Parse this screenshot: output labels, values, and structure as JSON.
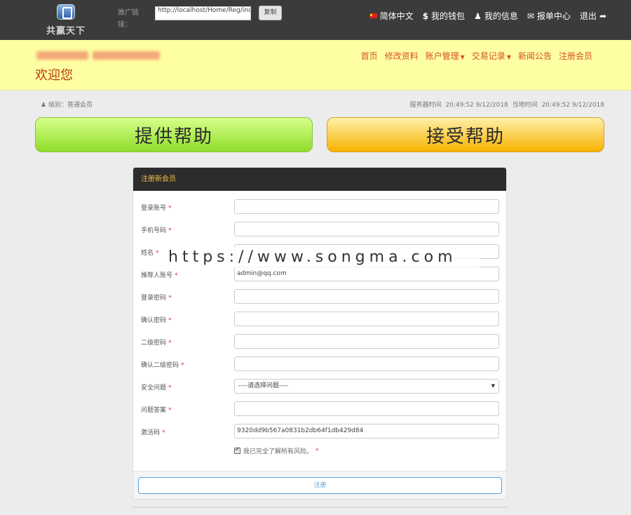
{
  "topbar": {
    "logo_text": "共赢天下",
    "promo_label": "推广链接：",
    "promo_url": "http://localhost/Home/Reg/index/u",
    "copy_label": "复制",
    "nav": {
      "language": "简体中文",
      "wallet": "我的钱包",
      "profile": "我的信息",
      "report_center": "报单中心",
      "logout": "退出"
    }
  },
  "banner": {
    "welcome": "欢迎您",
    "nav": [
      "首页",
      "修改资料",
      "账户管理",
      "交易记录",
      "新闻公告",
      "注册会员"
    ]
  },
  "info": {
    "level": "级别：普通会员",
    "server_time_label": "服务器时间",
    "server_time": "20:49:52 9/12/2018",
    "local_time_label": "当地时间",
    "local_time": "20:49:52 9/12/2018"
  },
  "actions": {
    "provide_help": "提供帮助",
    "accept_help": "接受帮助"
  },
  "form": {
    "title": "注册新会员",
    "fields": [
      {
        "label": "登录账号",
        "value": ""
      },
      {
        "label": "手机号码",
        "value": ""
      },
      {
        "label": "姓名",
        "value": ""
      },
      {
        "label": "推荐人账号",
        "value": "admin@qq.com"
      },
      {
        "label": "登录密码",
        "value": ""
      },
      {
        "label": "确认密码",
        "value": ""
      },
      {
        "label": "二级密码",
        "value": ""
      },
      {
        "label": "确认二级密码",
        "value": ""
      },
      {
        "label": "安全问题",
        "value": "----请选择问题----"
      },
      {
        "label": "问题答案",
        "value": ""
      },
      {
        "label": "激活码",
        "value": "9320dd9b567a0831b2db64f1db429d84"
      }
    ],
    "required_mark": "*",
    "agree_text": "我已完全了解所有风险。",
    "submit_label": "注册"
  },
  "watermark": "https://www.songma.com"
}
